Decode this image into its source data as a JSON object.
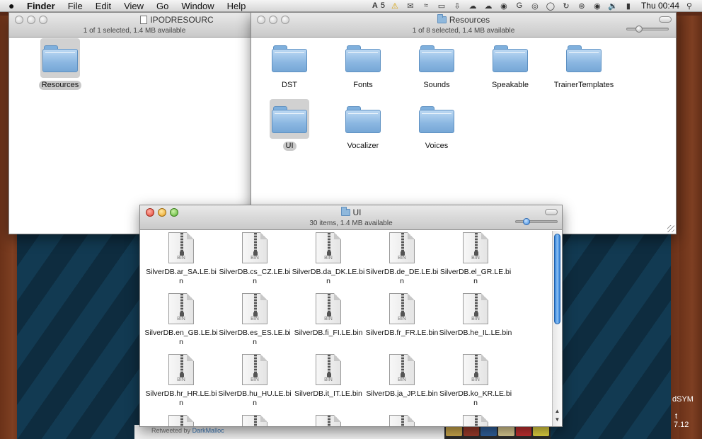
{
  "menubar": {
    "app": "Finder",
    "menus": [
      "File",
      "Edit",
      "View",
      "Go",
      "Window",
      "Help"
    ],
    "adobe_badge": "5",
    "clock": "Thu 00:44"
  },
  "window_ipod": {
    "title": "IPODRESOURC",
    "status": "1 of 1 selected, 1.4 MB available",
    "items": [
      {
        "label": "Resources"
      }
    ]
  },
  "window_resources": {
    "title": "Resources",
    "status": "1 of 8 selected, 1.4 MB available",
    "items": [
      {
        "label": "DST"
      },
      {
        "label": "Fonts"
      },
      {
        "label": "Sounds"
      },
      {
        "label": "Speakable"
      },
      {
        "label": "TrainerTemplates"
      },
      {
        "label": "UI"
      },
      {
        "label": "Vocalizer"
      },
      {
        "label": "Voices"
      }
    ],
    "selected": "UI"
  },
  "window_ui": {
    "title": "UI",
    "status": "30 items, 1.4 MB available",
    "files": [
      {
        "name": "SilverDB.ar_SA.LE.bin"
      },
      {
        "name": "SilverDB.cs_CZ.LE.bin"
      },
      {
        "name": "SilverDB.da_DK.LE.bin"
      },
      {
        "name": "SilverDB.de_DE.LE.bin"
      },
      {
        "name": "SilverDB.el_GR.LE.bin"
      },
      {
        "name": "SilverDB.en_GB.LE.bin"
      },
      {
        "name": "SilverDB.es_ES.LE.bin"
      },
      {
        "name": "SilverDB.fi_FI.LE.bin"
      },
      {
        "name": "SilverDB.fr_FR.LE.bin"
      },
      {
        "name": "SilverDB.he_IL.LE.bin"
      },
      {
        "name": "SilverDB.hr_HR.LE.bin"
      },
      {
        "name": "SilverDB.hu_HU.LE.bin"
      },
      {
        "name": "SilverDB.it_IT.LE.bin"
      },
      {
        "name": "SilverDB.ja_JP.LE.bin"
      },
      {
        "name": "SilverDB.ko_KR.LE.bin"
      }
    ],
    "file_badge": "BIN"
  },
  "desktop": {
    "retweet_prefix": "Retweeted by",
    "retweet_user": "DarkMalloc",
    "edge_text_1": "dSYM",
    "edge_text_2": "t",
    "edge_text_3": "7.12"
  }
}
